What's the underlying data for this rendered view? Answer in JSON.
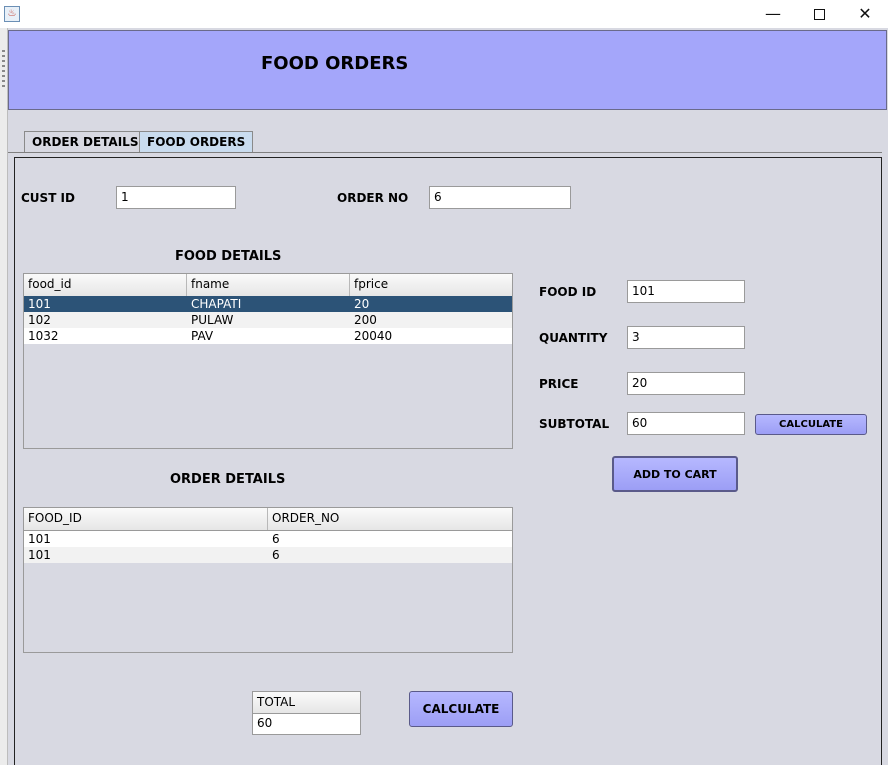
{
  "window": {
    "minimize_glyph": "—",
    "close_glyph": "✕"
  },
  "header": {
    "title": "FOOD ORDERS"
  },
  "tabs": [
    {
      "label": "ORDER DETAILS",
      "selected": false
    },
    {
      "label": "FOOD ORDERS",
      "selected": true
    }
  ],
  "customer": {
    "cust_id_label": "CUST ID",
    "cust_id_value": "1",
    "order_no_label": "ORDER NO",
    "order_no_value": "6"
  },
  "food_details": {
    "title": "FOOD DETAILS",
    "columns": [
      "food_id",
      "fname",
      "fprice"
    ],
    "rows": [
      [
        "101",
        "CHAPATI",
        "20"
      ],
      [
        "102",
        "PULAW",
        "200"
      ],
      [
        "1032",
        "PAV",
        "20040"
      ]
    ],
    "selected_row": 0
  },
  "order_details": {
    "title": "ORDER DETAILS",
    "columns": [
      "FOOD_ID",
      "ORDER_NO"
    ],
    "rows": [
      [
        "101",
        "6"
      ],
      [
        "101",
        "6"
      ]
    ]
  },
  "form": {
    "food_id_label": "FOOD ID",
    "food_id_value": "101",
    "quantity_label": "QUANTITY",
    "quantity_value": "3",
    "price_label": "PRICE",
    "price_value": "20",
    "subtotal_label": "SUBTOTAL",
    "subtotal_value": "60",
    "calculate_label": "CALCULATE",
    "add_to_cart_label": "ADD TO CART"
  },
  "total": {
    "header": "TOTAL",
    "value": "60",
    "calculate_label": "CALCULATE"
  },
  "colors": {
    "header_bg": "#a4a6fa",
    "panel_bg": "#d8d9e2",
    "button_bg": "#a4a6fa",
    "selected_row_bg": "#2c5377",
    "selected_tab_bg": "#c9dcef"
  }
}
